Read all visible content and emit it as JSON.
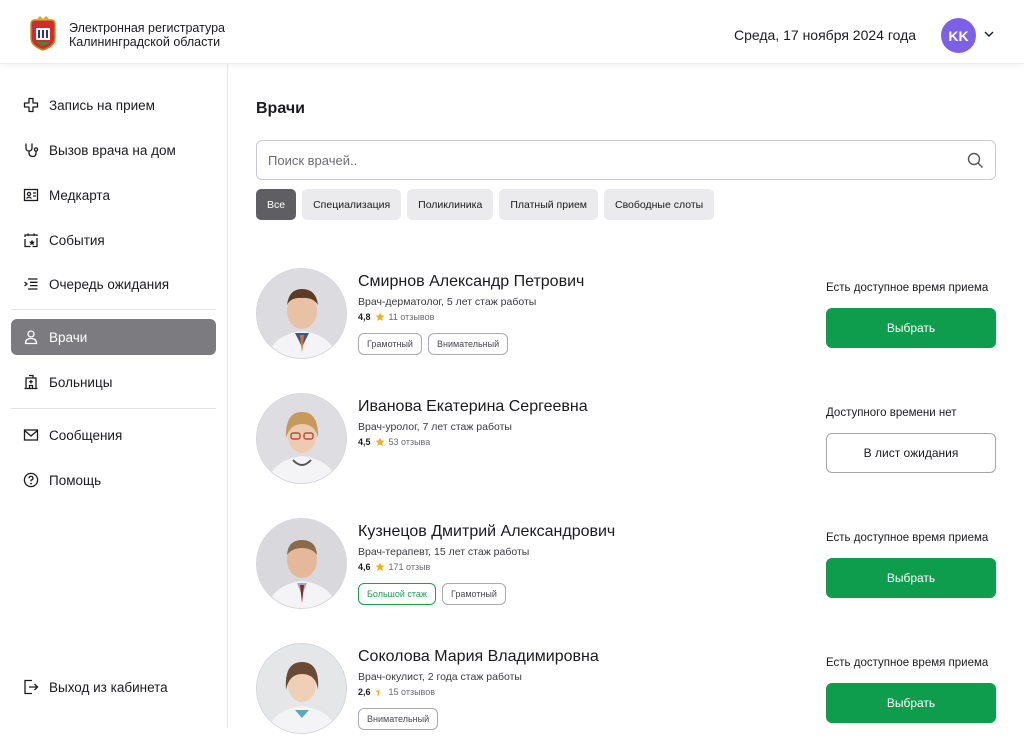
{
  "header": {
    "brand_line1": "Электронная регистратура",
    "brand_line2": "Калининградской области",
    "date": "Среда, 17 ноября 2024 года",
    "user_initials": "KK"
  },
  "sidebar": {
    "items": [
      {
        "label": "Запись на прием",
        "icon": "plus-cross-icon"
      },
      {
        "label": "Вызов врача на дом",
        "icon": "stethoscope-icon"
      },
      {
        "label": "Медкарта",
        "icon": "id-card-icon"
      },
      {
        "label": "События",
        "icon": "calendar-star-icon"
      },
      {
        "label": "Очередь ожидания",
        "icon": "queue-list-icon"
      },
      {
        "label": "Врачи",
        "icon": "user-icon",
        "active": true
      },
      {
        "label": "Больницы",
        "icon": "hospital-icon"
      },
      {
        "label": "Сообщения",
        "icon": "mail-icon"
      },
      {
        "label": "Помощь",
        "icon": "help-circle-icon"
      }
    ],
    "logout": "Выход из кабинета"
  },
  "main": {
    "title": "Врачи",
    "search_placeholder": "Поиск врачей..",
    "filters": [
      "Все",
      "Специализация",
      "Поликлиника",
      "Платный прием",
      "Свободные слоты"
    ],
    "active_filter": "Все"
  },
  "doctors": [
    {
      "name": "Смирнов Александр Петрович",
      "spec": "Врач-дерматолог, 5 лет стаж работы",
      "rating": "4,8",
      "reviews": "11 отзывов",
      "tags": [
        {
          "label": "Грамотный",
          "style": "gray"
        },
        {
          "label": "Внимательный",
          "style": "gray"
        }
      ],
      "availability": "Есть доступное время приема",
      "action": "Выбрать",
      "action_style": "primary"
    },
    {
      "name": "Иванова Екатерина Сергеевна",
      "spec": "Врач-уролог, 7 лет стаж работы",
      "rating": "4,5",
      "reviews": "53 отзыва",
      "tags": [],
      "availability": "Доступного времени нет",
      "action": "В лист ожидания",
      "action_style": "outline"
    },
    {
      "name": "Кузнецов Дмитрий Александрович",
      "spec": "Врач-терапевт, 15 лет стаж работы",
      "rating": "4,6",
      "reviews": "171 отзыв",
      "tags": [
        {
          "label": "Большой стаж",
          "style": "green"
        },
        {
          "label": "Грамотный",
          "style": "gray"
        }
      ],
      "availability": "Есть доступное время приема",
      "action": "Выбрать",
      "action_style": "primary"
    },
    {
      "name": "Соколова Мария Владимировна",
      "spec": "Врач-окулист, 2 года стаж работы",
      "rating": "2,6",
      "reviews": "15 отзывов",
      "tags": [
        {
          "label": "Внимательный",
          "style": "gray"
        }
      ],
      "availability": "Есть доступное время приема",
      "action": "Выбрать",
      "action_style": "primary"
    }
  ],
  "colors": {
    "accent_green": "#0e9c4d",
    "avatar": "#7c61e8",
    "active_nav": "#7b7b80",
    "star": "#f2b01e"
  }
}
